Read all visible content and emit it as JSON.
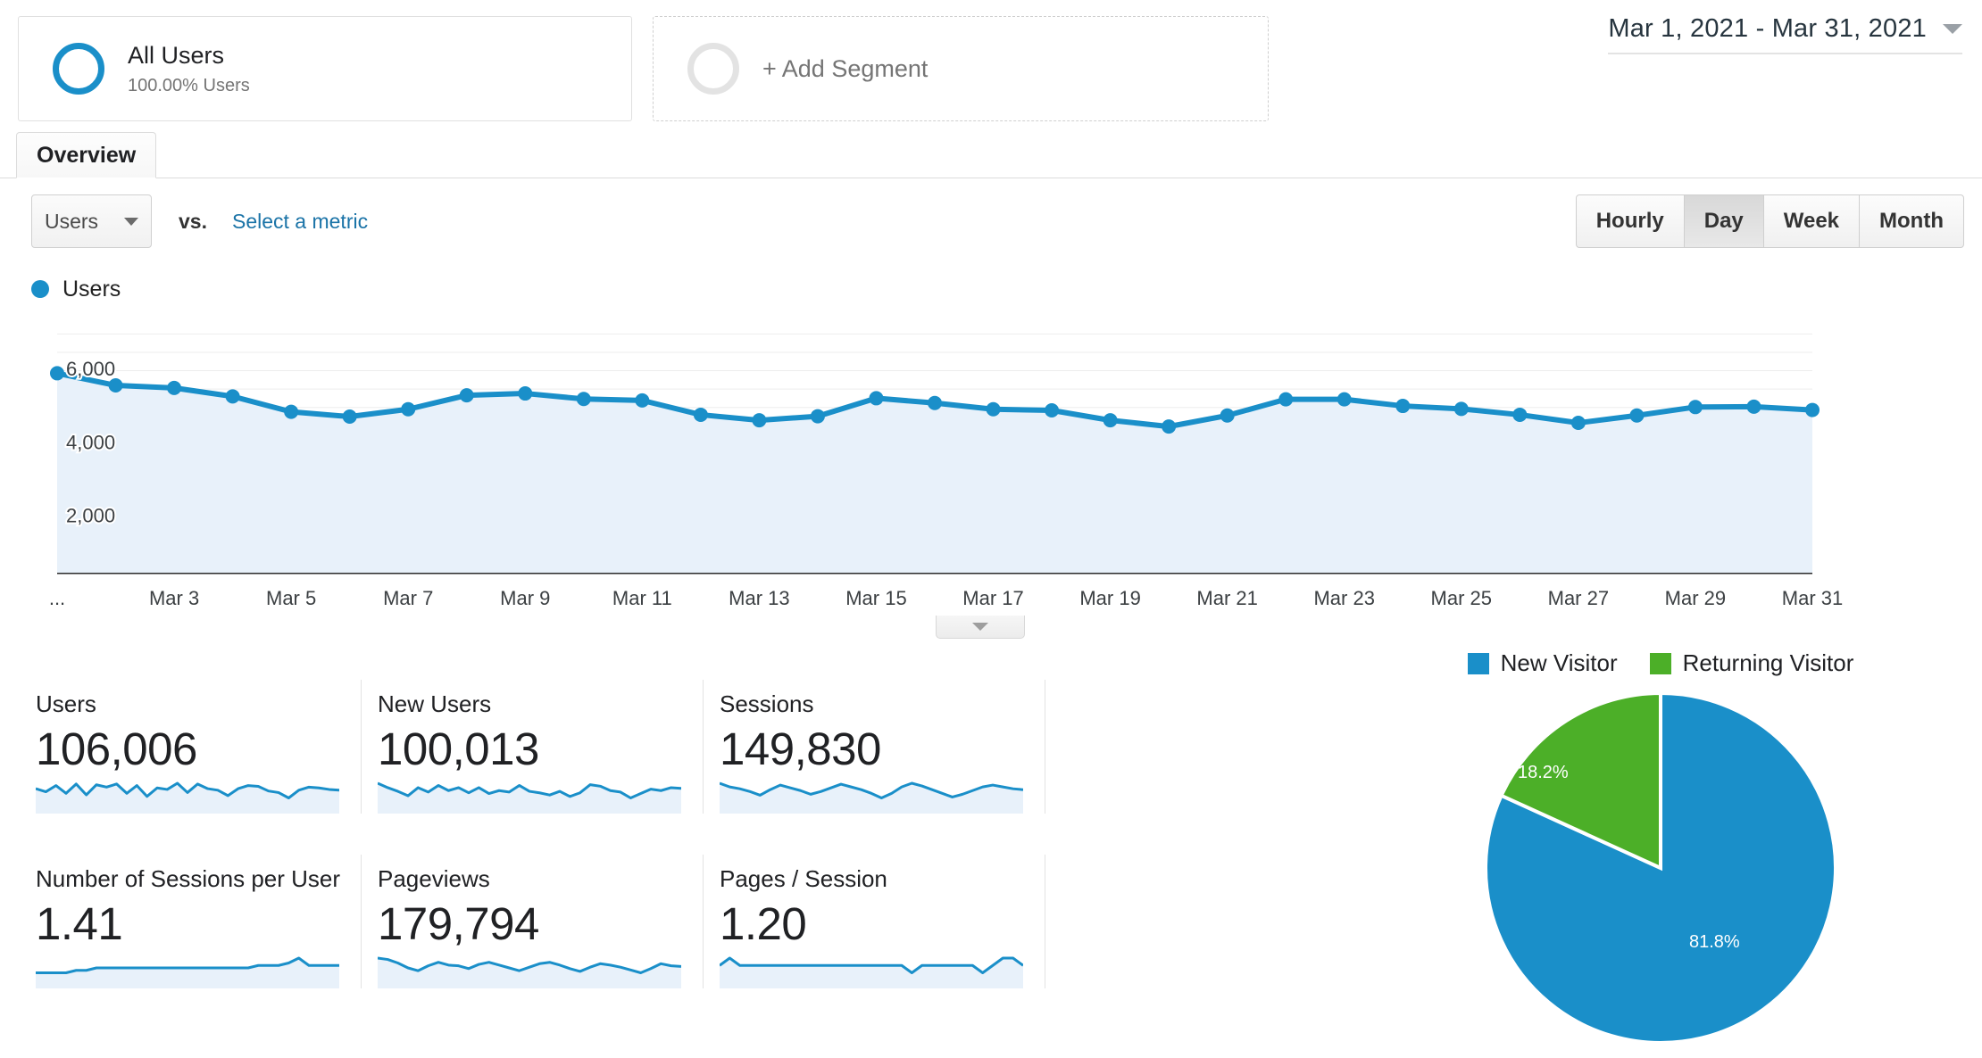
{
  "segments": {
    "all_users": {
      "title": "All Users",
      "subtitle": "100.00% Users"
    },
    "add_segment_label": "+ Add Segment"
  },
  "date_range": {
    "label": "Mar 1, 2021 - Mar 31, 2021"
  },
  "tabs": [
    {
      "label": "Overview",
      "active": true
    }
  ],
  "metric_selector": {
    "primary_metric": "Users",
    "vs_label": "vs.",
    "secondary_metric_link": "Select a metric"
  },
  "granularity": {
    "options": [
      "Hourly",
      "Day",
      "Week",
      "Month"
    ],
    "selected": "Day"
  },
  "chart_legend": {
    "series_label": "Users"
  },
  "colors": {
    "accent_blue": "#1a8fc9",
    "area_fill": "#e8f1fa",
    "green": "#4caf28",
    "link_blue": "#1a73a7"
  },
  "chart_data": {
    "type": "line",
    "title": "Users",
    "xlabel": "",
    "ylabel": "Users",
    "ylim": [
      0,
      6800
    ],
    "grid": true,
    "legend_position": "top-left",
    "yticks": [
      2000,
      4000,
      6000
    ],
    "ytick_labels": [
      "2,000",
      "4,000",
      "6,000"
    ],
    "xtick_labels": [
      "...",
      "Mar 3",
      "Mar 5",
      "Mar 7",
      "Mar 9",
      "Mar 11",
      "Mar 13",
      "Mar 15",
      "Mar 17",
      "Mar 19",
      "Mar 21",
      "Mar 23",
      "Mar 25",
      "Mar 27",
      "Mar 29",
      "Mar 31"
    ],
    "x": [
      "Mar 1",
      "Mar 2",
      "Mar 3",
      "Mar 4",
      "Mar 5",
      "Mar 6",
      "Mar 7",
      "Mar 8",
      "Mar 9",
      "Mar 10",
      "Mar 11",
      "Mar 12",
      "Mar 13",
      "Mar 14",
      "Mar 15",
      "Mar 16",
      "Mar 17",
      "Mar 18",
      "Mar 19",
      "Mar 20",
      "Mar 21",
      "Mar 22",
      "Mar 23",
      "Mar 24",
      "Mar 25",
      "Mar 26",
      "Mar 27",
      "Mar 28",
      "Mar 29",
      "Mar 30",
      "Mar 31"
    ],
    "series": [
      {
        "name": "Users",
        "values": [
          5430,
          5100,
          5030,
          4800,
          4380,
          4250,
          4450,
          4830,
          4880,
          4730,
          4690,
          4300,
          4150,
          4260,
          4750,
          4620,
          4450,
          4420,
          4150,
          3980,
          4280,
          4720,
          4720,
          4540,
          4460,
          4300,
          4080,
          4280,
          4510,
          4520,
          4430
        ]
      }
    ]
  },
  "metric_cards": [
    [
      {
        "label": "Users",
        "value": "106,006"
      },
      {
        "label": "New Users",
        "value": "100,013"
      },
      {
        "label": "Sessions",
        "value": "149,830"
      }
    ],
    [
      {
        "label": "Number of Sessions per User",
        "value": "1.41"
      },
      {
        "label": "Pageviews",
        "value": "179,794"
      },
      {
        "label": "Pages / Session",
        "value": "1.20"
      }
    ]
  ],
  "sparklines": {
    "users": [
      52,
      48,
      56,
      46,
      58,
      44,
      57,
      54,
      58,
      46,
      56,
      42,
      53,
      51,
      59,
      47,
      58,
      52,
      50,
      43,
      52,
      56,
      55,
      49,
      47,
      40,
      50,
      54,
      53,
      51,
      50
    ],
    "new_users": [
      58,
      52,
      47,
      41,
      52,
      46,
      55,
      48,
      52,
      45,
      52,
      44,
      48,
      46,
      55,
      47,
      45,
      42,
      47,
      40,
      45,
      56,
      54,
      48,
      46,
      38,
      44,
      50,
      48,
      52,
      51
    ],
    "sessions": [
      56,
      52,
      50,
      47,
      43,
      49,
      54,
      51,
      48,
      44,
      47,
      51,
      55,
      52,
      49,
      45,
      40,
      45,
      52,
      56,
      53,
      49,
      45,
      41,
      44,
      48,
      52,
      54,
      52,
      50,
      49
    ],
    "sessions_per_user": [
      50,
      50,
      50,
      50,
      51,
      51,
      52,
      52,
      52,
      52,
      52,
      52,
      52,
      52,
      52,
      52,
      52,
      52,
      52,
      52,
      52,
      52,
      53,
      53,
      53,
      54,
      56,
      53,
      53,
      53,
      53
    ],
    "pageviews": [
      58,
      56,
      51,
      44,
      40,
      47,
      52,
      48,
      47,
      43,
      49,
      52,
      48,
      44,
      40,
      45,
      50,
      52,
      48,
      43,
      39,
      45,
      50,
      48,
      45,
      41,
      37,
      43,
      50,
      47,
      46
    ],
    "pages_per_session": [
      50,
      51,
      50,
      50,
      50,
      50,
      50,
      50,
      50,
      50,
      50,
      50,
      50,
      50,
      50,
      50,
      50,
      50,
      50,
      49,
      50,
      50,
      50,
      50,
      50,
      50,
      49,
      50,
      51,
      51,
      50
    ]
  },
  "pie_chart": {
    "type": "pie",
    "title": "",
    "labels": [
      "New Visitor",
      "Returning Visitor"
    ],
    "values": [
      81.8,
      18.2
    ],
    "value_labels": [
      "81.8%",
      "18.2%"
    ],
    "colors": [
      "#1a8fc9",
      "#4caf28"
    ],
    "legend_position": "top"
  }
}
